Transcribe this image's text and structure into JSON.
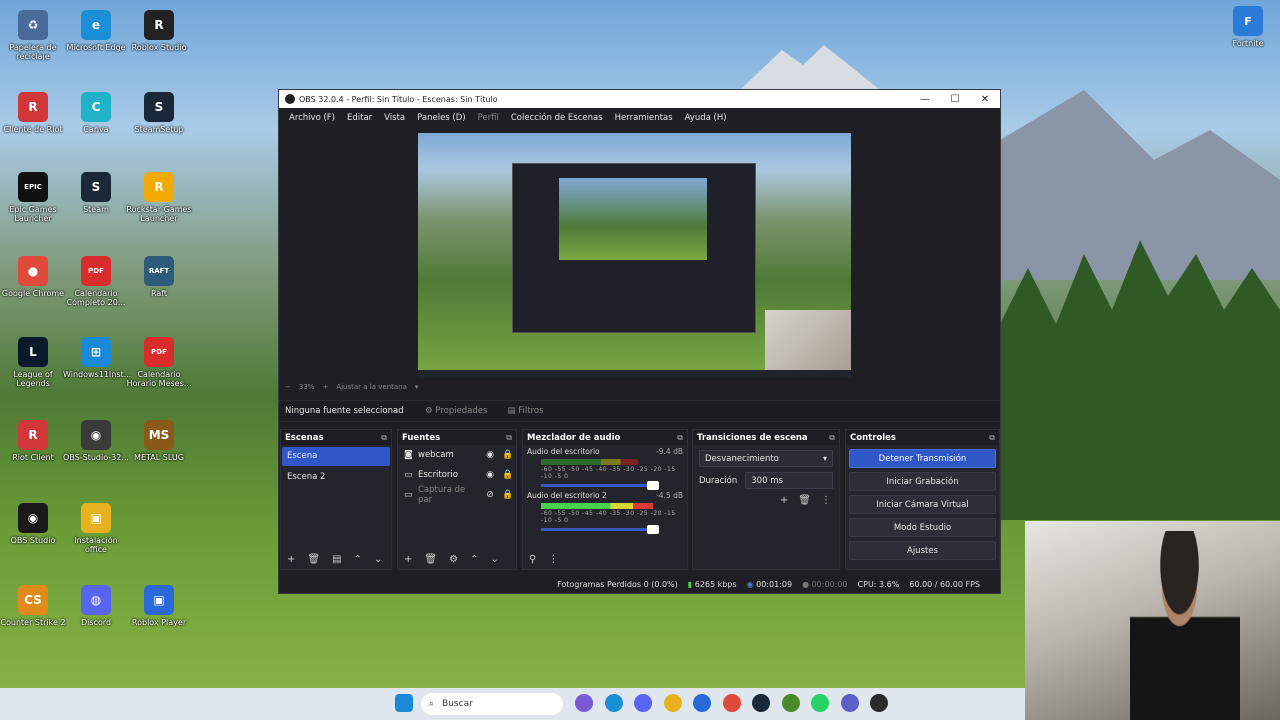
{
  "desktop": {
    "icons": [
      {
        "label": "Papelera de reciclaje",
        "glyph": "♻",
        "color": "#4a6a9a"
      },
      {
        "label": "Microsoft Edge",
        "glyph": "e",
        "color": "#1b8fd6"
      },
      {
        "label": "Roblox Studio",
        "glyph": "R",
        "color": "#222"
      },
      {
        "label": "Cliente de Riot",
        "glyph": "R",
        "color": "#d13639"
      },
      {
        "label": "Canva",
        "glyph": "C",
        "color": "#20b2c8"
      },
      {
        "label": "SteamSetup",
        "glyph": "S",
        "color": "#1b2838"
      },
      {
        "label": "Epic Games Launcher",
        "glyph": "EPIC",
        "color": "#111"
      },
      {
        "label": "Steam",
        "glyph": "S",
        "color": "#1b2838"
      },
      {
        "label": "Rockstar Games Launcher",
        "glyph": "R",
        "color": "#f2a900"
      },
      {
        "label": "Google Chrome",
        "glyph": "●",
        "color": "#e04a3a"
      },
      {
        "label": "Calendario Completo 20...",
        "glyph": "PDF",
        "color": "#d92d2d"
      },
      {
        "label": "Raft",
        "glyph": "RAFT",
        "color": "#2c5c7a"
      },
      {
        "label": "League of Legends",
        "glyph": "L",
        "color": "#0a1a2a"
      },
      {
        "label": "Windows11Inst...",
        "glyph": "⊞",
        "color": "#1a8ad8"
      },
      {
        "label": "Calendario Horario Meses...",
        "glyph": "PDF",
        "color": "#d92d2d"
      },
      {
        "label": "Riot Client",
        "glyph": "R",
        "color": "#d13639"
      },
      {
        "label": "OBS-Studio-32...",
        "glyph": "◉",
        "color": "#3a3a3a"
      },
      {
        "label": "METAL SLUG",
        "glyph": "MS",
        "color": "#8a5a1a"
      },
      {
        "label": "OBS Studio",
        "glyph": "◉",
        "color": "#1a1a1a"
      },
      {
        "label": "Instalación office",
        "glyph": "▣",
        "color": "#e8b21f"
      },
      {
        "label": "Counter Strike 2",
        "glyph": "CS",
        "color": "#e08a1a"
      },
      {
        "label": "Discord",
        "glyph": "◍",
        "color": "#5865f2"
      },
      {
        "label": "Roblox Player",
        "glyph": "▣",
        "color": "#2a6ad8"
      },
      {
        "label": "Fortnite",
        "glyph": "F",
        "color": "#2a7ad8"
      }
    ]
  },
  "obs": {
    "title": "OBS 32.0.4 - Perfil: Sin Título - Escenas: Sin Título",
    "menu": [
      {
        "label": "Archivo (F)",
        "dim": false
      },
      {
        "label": "Editar",
        "dim": false
      },
      {
        "label": "Vista",
        "dim": false
      },
      {
        "label": "Paneles (D)",
        "dim": false
      },
      {
        "label": "Perfil",
        "dim": true
      },
      {
        "label": "Colección de Escenas",
        "dim": false
      },
      {
        "label": "Herramientas",
        "dim": false
      },
      {
        "label": "Ayuda (H)",
        "dim": false
      }
    ],
    "zoom": {
      "minus": "−",
      "value": "33%",
      "plus": "+",
      "fit": "Ajustar a la ventana"
    },
    "no_source": "Ninguna fuente seleccionad",
    "properties_label": "Propiedades",
    "filters_label": "Filtros",
    "scenes": {
      "title": "Escenas",
      "items": [
        {
          "label": "Escena",
          "selected": true
        },
        {
          "label": "Escena 2",
          "selected": false
        }
      ]
    },
    "sources": {
      "title": "Fuentes",
      "items": [
        {
          "label": "webcam",
          "icon": "📷",
          "dim": false
        },
        {
          "label": "Escritorio",
          "icon": "▭",
          "dim": false
        },
        {
          "label": "Captura de par",
          "icon": "▭",
          "dim": true
        }
      ]
    },
    "mixer": {
      "title": "Mezclador de audio",
      "channels": [
        {
          "name": "Audio del escritorio",
          "db": "-9.4 dB",
          "level": 0.62,
          "live": false
        },
        {
          "name": "Audio del escritorio 2",
          "db": "-4.5 dB",
          "level": 0.72,
          "live": true
        }
      ],
      "scale": "-60 -55 -50 -45 -40 -35 -30 -25 -20 -15 -10 -5 0"
    },
    "transitions": {
      "title": "Transiciones de escena",
      "selected": "Desvanecimiento",
      "duration_label": "Duración",
      "duration_value": "300 ms"
    },
    "controls": {
      "title": "Controles",
      "buttons": [
        {
          "label": "Detener Transmisión",
          "active": true
        },
        {
          "label": "Iniciar Grabación",
          "active": false
        },
        {
          "label": "Iniciar Cámara Virtual",
          "active": false
        },
        {
          "label": "Modo Estudio",
          "active": false
        },
        {
          "label": "Ajustes",
          "active": false
        }
      ]
    },
    "status": {
      "dropped": "Fotogramas Perdidos 0 (0.0%)",
      "bitrate": "6265 kbps",
      "stream_time": "00:01:09",
      "rec_time": "00:00:00",
      "cpu": "CPU: 3.6%",
      "fps": "60.00 / 60.00 FPS"
    }
  },
  "taskbar": {
    "search_placeholder": "Buscar",
    "apps": [
      "windows-start",
      "copilot",
      "edge",
      "discord",
      "file-explorer",
      "store",
      "chrome",
      "steam",
      "minecraft",
      "whatsapp",
      "teams",
      "obs"
    ]
  }
}
